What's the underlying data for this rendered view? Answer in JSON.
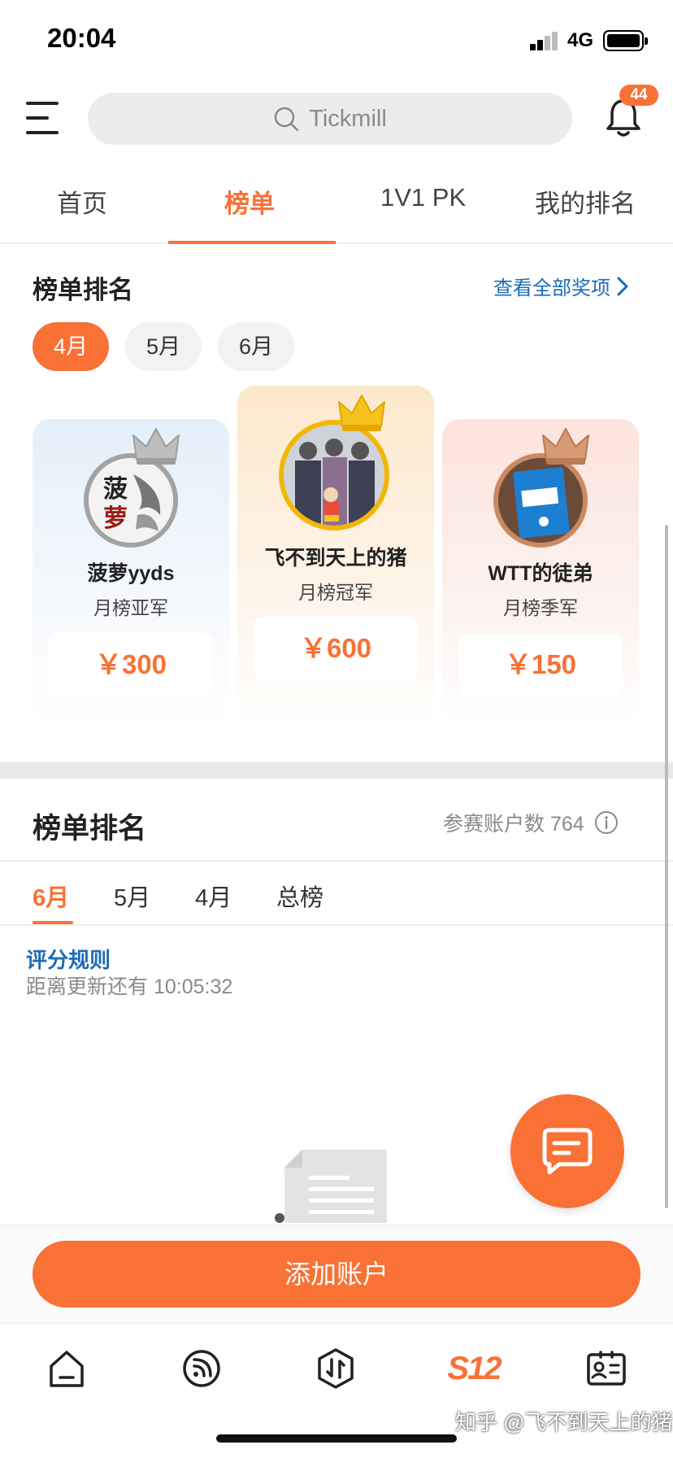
{
  "status_bar": {
    "time": "20:04",
    "network": "4G"
  },
  "header": {
    "search_placeholder": "Tickmill",
    "notification_count": "44"
  },
  "top_tabs": [
    {
      "label": "首页",
      "active": false
    },
    {
      "label": "榜单",
      "active": true
    },
    {
      "label": "1V1 PK",
      "active": false
    },
    {
      "label": "我的排名",
      "active": false
    }
  ],
  "awards": {
    "title": "榜单排名",
    "view_all": "查看全部奖项",
    "months": [
      {
        "label": "4月",
        "active": true
      },
      {
        "label": "5月",
        "active": false
      },
      {
        "label": "6月",
        "active": false
      }
    ],
    "winners": [
      {
        "name": "菠萝yyds",
        "rank": "月榜亚军",
        "prize": "￥300",
        "medal": "silver"
      },
      {
        "name": "飞不到天上的猪",
        "rank": "月榜冠军",
        "prize": "￥600",
        "medal": "gold"
      },
      {
        "name": "WTT的徒弟",
        "rank": "月榜季军",
        "prize": "￥150",
        "medal": "bronze"
      }
    ]
  },
  "ranking": {
    "title": "榜单排名",
    "participants": "参赛账户数 764",
    "tabs": [
      {
        "label": "6月",
        "active": true
      },
      {
        "label": "5月",
        "active": false
      },
      {
        "label": "4月",
        "active": false
      },
      {
        "label": "总榜",
        "active": false
      }
    ],
    "rules_link": "评分规则",
    "countdown": "距离更新还有 10:05:32"
  },
  "add_account_button": "添加账户",
  "watermark": "知乎 @飞不到天上的猪",
  "colors": {
    "accent": "#f97135",
    "link": "#1d6bb7",
    "muted": "#8a8a8a"
  },
  "icons": {
    "bottom_nav": [
      "home-icon",
      "feed-icon",
      "exchange-icon",
      "s12-logo",
      "profile-card-icon"
    ]
  }
}
